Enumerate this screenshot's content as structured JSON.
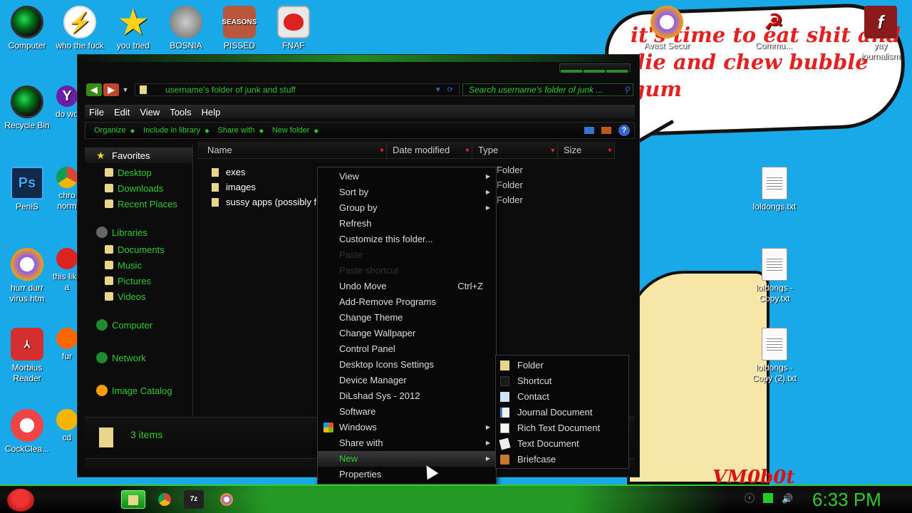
{
  "desktop": {
    "bubble_text": "it's time to eat shit and die and chew bubble gum",
    "signature": "VM0b0t",
    "icons": [
      {
        "label": "Computer"
      },
      {
        "label": "who the fuck"
      },
      {
        "label": "you tried"
      },
      {
        "label": "BOSNIA"
      },
      {
        "label": "PISSED"
      },
      {
        "label": "FNAF"
      },
      {
        "label": "Avast Secur"
      },
      {
        "label": "Commu..."
      },
      {
        "label": "yay journalism"
      },
      {
        "label": "Recycle Bin"
      },
      {
        "label": "do wo"
      },
      {
        "label": "PeniS"
      },
      {
        "label": "chro norm"
      },
      {
        "label": "hurr durr virus.htm"
      },
      {
        "label": "this like a"
      },
      {
        "label": "Morbius Reader"
      },
      {
        "label": "fur"
      },
      {
        "label": "CockClea..."
      },
      {
        "label": "cd"
      },
      {
        "label": "loldongs.txt"
      },
      {
        "label": "loldongs - Copy.txt"
      },
      {
        "label": "loldongs - Copy (2).txt"
      }
    ]
  },
  "explorer": {
    "address": "username's folder of junk and stuff",
    "search_placeholder": "Search username's folder of junk ...",
    "menus": [
      "File",
      "Edit",
      "View",
      "Tools",
      "Help"
    ],
    "commands": [
      "Organize",
      "Include in library",
      "Share with",
      "New folder"
    ],
    "nav": {
      "favorites": "Favorites",
      "fav_items": [
        "Desktop",
        "Downloads",
        "Recent Places"
      ],
      "libraries": "Libraries",
      "lib_items": [
        "Documents",
        "Music",
        "Pictures",
        "Videos"
      ],
      "computer": "Computer",
      "network": "Network",
      "catalog": "Image Catalog"
    },
    "columns": [
      "Name",
      "Date modified",
      "Type",
      "Size"
    ],
    "files": [
      {
        "name": "exes",
        "type": "Folder"
      },
      {
        "name": "images",
        "type": "Folder"
      },
      {
        "name": "sussy apps (possibly f",
        "type": "Folder"
      }
    ],
    "status_count": "3 items"
  },
  "context_menu": {
    "items": [
      {
        "label": "View",
        "submenu": true
      },
      {
        "label": "Sort by",
        "submenu": true
      },
      {
        "label": "Group by",
        "submenu": true
      },
      {
        "label": "Refresh"
      },
      {
        "label": "Customize this folder..."
      },
      {
        "label": "Paste",
        "disabled": true
      },
      {
        "label": "Paste shortcut",
        "disabled": true
      },
      {
        "label": "Undo Move",
        "shortcut": "Ctrl+Z"
      },
      {
        "label": "Add-Remove Programs"
      },
      {
        "label": "Change Theme"
      },
      {
        "label": "Change Wallpaper"
      },
      {
        "label": "Control Panel"
      },
      {
        "label": "Desktop Icons Settings"
      },
      {
        "label": "Device Manager"
      },
      {
        "label": "DiLshad Sys - 2012"
      },
      {
        "label": "Software"
      },
      {
        "label": "Windows",
        "submenu": true
      },
      {
        "label": "Share with",
        "submenu": true
      },
      {
        "label": "New",
        "submenu": true,
        "selected": true
      },
      {
        "label": "Properties"
      }
    ]
  },
  "new_submenu": {
    "items": [
      "Folder",
      "Shortcut",
      "Contact",
      "Journal Document",
      "Rich Text Document",
      "Text Document",
      "Briefcase"
    ]
  },
  "taskbar": {
    "clock": "6:33 PM"
  }
}
